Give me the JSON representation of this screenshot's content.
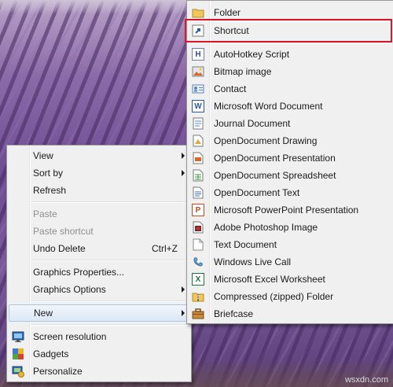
{
  "context_menu": {
    "items": [
      {
        "label": "View",
        "submenu": true
      },
      {
        "label": "Sort by",
        "submenu": true
      },
      {
        "label": "Refresh"
      },
      {
        "label": "Paste",
        "disabled": true
      },
      {
        "label": "Paste shortcut",
        "disabled": true
      },
      {
        "label": "Undo Delete",
        "shortcut": "Ctrl+Z"
      },
      {
        "label": "Graphics Properties..."
      },
      {
        "label": "Graphics Options",
        "submenu": true
      },
      {
        "label": "New",
        "submenu": true,
        "highlighted": true
      },
      {
        "label": "Screen resolution",
        "icon": "screen-resolution-icon"
      },
      {
        "label": "Gadgets",
        "icon": "gadgets-icon"
      },
      {
        "label": "Personalize",
        "icon": "personalize-icon"
      }
    ]
  },
  "new_submenu": {
    "items": [
      {
        "label": "Folder",
        "icon": "folder-icon"
      },
      {
        "label": "Shortcut",
        "icon": "shortcut-icon",
        "outlined": true
      },
      {
        "label": "AutoHotkey Script",
        "icon": "autohotkey-script-icon"
      },
      {
        "label": "Bitmap image",
        "icon": "bitmap-image-icon"
      },
      {
        "label": "Contact",
        "icon": "contact-icon"
      },
      {
        "label": "Microsoft Word Document",
        "icon": "word-document-icon"
      },
      {
        "label": "Journal Document",
        "icon": "journal-document-icon"
      },
      {
        "label": "OpenDocument Drawing",
        "icon": "opendocument-drawing-icon"
      },
      {
        "label": "OpenDocument Presentation",
        "icon": "opendocument-presentation-icon"
      },
      {
        "label": "OpenDocument Spreadsheet",
        "icon": "opendocument-spreadsheet-icon"
      },
      {
        "label": "OpenDocument Text",
        "icon": "opendocument-text-icon"
      },
      {
        "label": "Microsoft PowerPoint Presentation",
        "icon": "powerpoint-presentation-icon"
      },
      {
        "label": "Adobe Photoshop Image",
        "icon": "photoshop-image-icon"
      },
      {
        "label": "Text Document",
        "icon": "text-document-icon"
      },
      {
        "label": "Windows Live Call",
        "icon": "windows-live-call-icon"
      },
      {
        "label": "Microsoft Excel Worksheet",
        "icon": "excel-worksheet-icon"
      },
      {
        "label": "Compressed (zipped) Folder",
        "icon": "zipped-folder-icon"
      },
      {
        "label": "Briefcase",
        "icon": "briefcase-icon"
      }
    ]
  },
  "watermark": "wsxdn.com",
  "colors": {
    "menu_background": "#f0f0f0",
    "highlight_outline": "#d8182a",
    "hover_border": "#a8c8ea"
  }
}
